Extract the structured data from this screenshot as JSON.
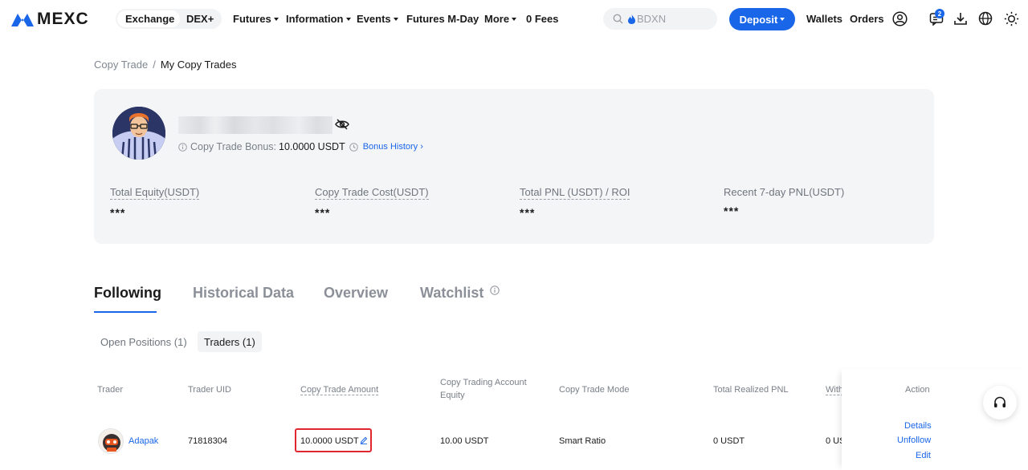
{
  "nav": {
    "brand": "MEXC",
    "exchange_label": "Exchange",
    "dex_label": "DEX+",
    "futures_label": "Futures",
    "information_label": "Information",
    "events_label": "Events",
    "futures_mday_label": "Futures M-Day",
    "more_label": "More",
    "fees_label": "0 Fees",
    "search_placeholder": "BDXN",
    "deposit_label": "Deposit",
    "wallets_label": "Wallets",
    "orders_label": "Orders",
    "notification_count": "2"
  },
  "breadcrumb": {
    "parent": "Copy Trade",
    "separator": "/",
    "current": "My Copy Trades"
  },
  "profile": {
    "bonus_label": "Copy Trade Bonus:",
    "bonus_value": "10.0000 USDT",
    "bonus_history_label": "Bonus History"
  },
  "stats": [
    {
      "label": "Total Equity(USDT)",
      "value": "***"
    },
    {
      "label": "Copy Trade Cost(USDT)",
      "value": "***"
    },
    {
      "label": "Total PNL (USDT) / ROI",
      "value": "***"
    },
    {
      "label": "Recent 7-day PNL(USDT)",
      "value": "***"
    }
  ],
  "tabs": {
    "following": "Following",
    "historical": "Historical Data",
    "overview": "Overview",
    "watchlist": "Watchlist"
  },
  "subtabs": {
    "open_positions": "Open Positions (1)",
    "traders": "Traders (1)"
  },
  "table": {
    "headers": {
      "trader": "Trader",
      "uid": "Trader UID",
      "amount": "Copy Trade Amount",
      "equity_line1": "Copy Trading Account",
      "equity_line2": "Equity",
      "mode": "Copy Trade Mode",
      "pnl": "Total Realized PNL",
      "withdraw": "With",
      "action": "Action"
    },
    "row": {
      "trader": "Adapak",
      "uid": "71818304",
      "amount": "10.0000 USDT",
      "equity": "10.00 USDT",
      "mode": "Smart Ratio",
      "pnl": "0 USDT",
      "withdraw": "0 US",
      "details": "Details",
      "unfollow": "Unfollow",
      "edit": "Edit"
    }
  },
  "colors": {
    "accent": "#1a66e8",
    "highlight": "#e0272f"
  }
}
